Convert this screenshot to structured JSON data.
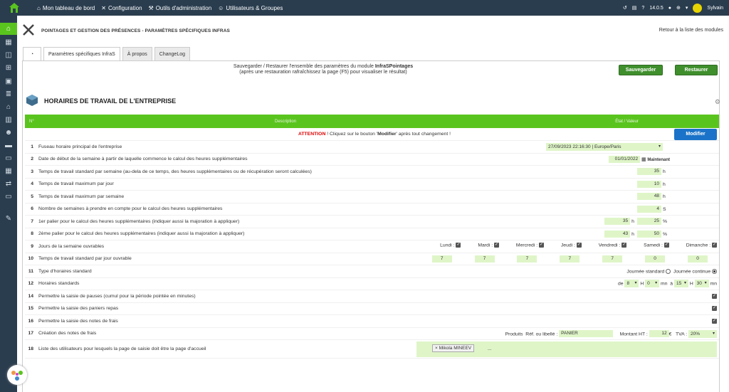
{
  "topbar": {
    "items": [
      {
        "label": "Mon tableau de bord"
      },
      {
        "label": "Configuration"
      },
      {
        "label": "Outils d'administration"
      },
      {
        "label": "Utilisateurs & Groupes"
      }
    ],
    "version": "14.0.5",
    "user": "Sylvain",
    "avatar_text": "Sylvain"
  },
  "page": {
    "title": "POINTAGES ET GESTION DES PRÉSENCES - PARAMÈTRES SPÉCIFIQUES INFRAS",
    "back_link": "Retour à la liste des modules"
  },
  "tabs": [
    {
      "label": "Paramètres spécifiques InfraS"
    },
    {
      "label": "À propos"
    },
    {
      "label": "ChangeLog"
    }
  ],
  "backup": {
    "line1_prefix": "Sauvegarder / Restaurer l'ensemble des paramètres du module ",
    "module": "InfraSPointages",
    "line2": "(après une restauration rafraîchissez la page (F5) pour visualiser le résultat)",
    "save": "Sauvegarder",
    "restore": "Restaurer"
  },
  "section": {
    "title": "HORAIRES DE TRAVAIL DE L'ENTREPRISE",
    "col_num": "N°",
    "col_desc": "Description",
    "col_val": "État / Valeur"
  },
  "attention": {
    "label": "ATTENTION",
    "text1": " ! Cliquez sur le bouton '",
    "btn_word": "Modifier",
    "text2": "' après tout changement !",
    "button": "Modifier"
  },
  "rows": {
    "r1": {
      "n": "1",
      "d": "Fuseau horaire principal de l'entreprise",
      "v": "27/09/2023 22:16:30 | Europe/Paris"
    },
    "r2": {
      "n": "2",
      "d": "Date de début de la semaine à partir de laquelle commence le calcul des heures supplémentaires",
      "v": "01/01/2022",
      "link": "Maintenant"
    },
    "r3": {
      "n": "3",
      "d": "Temps de travail standard par semaine (au-dela de ce temps, des heures supplémentaires ou de récupération seront calculées)",
      "v": "35",
      "u": "h"
    },
    "r4": {
      "n": "4",
      "d": "Temps de travail maximum par jour",
      "v": "10",
      "u": "h"
    },
    "r5": {
      "n": "5",
      "d": "Temps de travail maximum par semaine",
      "v": "48",
      "u": "h"
    },
    "r6": {
      "n": "6",
      "d": "Nombre de semaines à prendre en compte pour le calcul des heures supplémentaires",
      "v": "4",
      "u": "S"
    },
    "r7": {
      "n": "7",
      "d": "1er palier pour le calcul des heures supplémentaires (indiquer aussi la majoration à appliquer)",
      "v": "35",
      "u": "h",
      "p": "25",
      "pu": "%"
    },
    "r8": {
      "n": "8",
      "d": "2ème palier pour le calcul des heures supplémentaires (indiquer aussi la majoration à appliquer)",
      "v": "43",
      "u": "h",
      "p": "50",
      "pu": "%"
    },
    "r9": {
      "n": "9",
      "d": "Jours de la semaine ouvrables",
      "days": [
        "Lundi :",
        "Mardi :",
        "Mercredi :",
        "Jeudi :",
        "Vendredi :",
        "Samedi :",
        "Dimanche :"
      ]
    },
    "r10": {
      "n": "10",
      "d": "Temps de travail standard par jour ouvrable",
      "vals": [
        "7",
        "7",
        "7",
        "7",
        "7",
        "0",
        "0"
      ]
    },
    "r11": {
      "n": "11",
      "d": "Type d'horaires standard",
      "o1": "Journée standard",
      "o2": "Journée continue"
    },
    "r12": {
      "n": "12",
      "d": "Horaires standards",
      "de": "de",
      "h1": "8",
      "hl": "H",
      "m1": "0",
      "mn": "mn",
      "a": "à",
      "h2": "15",
      "m2": "30"
    },
    "r14": {
      "n": "14",
      "d": "Permettre la saisie de pauses (cumul pour la période pointée en minutes)"
    },
    "r15": {
      "n": "15",
      "d": "Permettre la saisie des paniers repas"
    },
    "r16": {
      "n": "16",
      "d": "Permettre la saisie des notes de frais"
    },
    "r17": {
      "n": "17",
      "d": "Création des notes de frais",
      "products": "Produits",
      "ref": "Réf. ou libellé :",
      "ref_val": "PANIER",
      "ht": "Montant HT :",
      "ht_val": "12",
      "cur": "€",
      "tva": "TVA :",
      "tva_val": "20%"
    },
    "r18": {
      "n": "18",
      "d": "Liste des utilisateurs pour lesquels la page de saisie doit être la page d'accueil",
      "chip": "× Mikola MINEEV",
      "more": "..."
    }
  },
  "checkmark": "✓"
}
